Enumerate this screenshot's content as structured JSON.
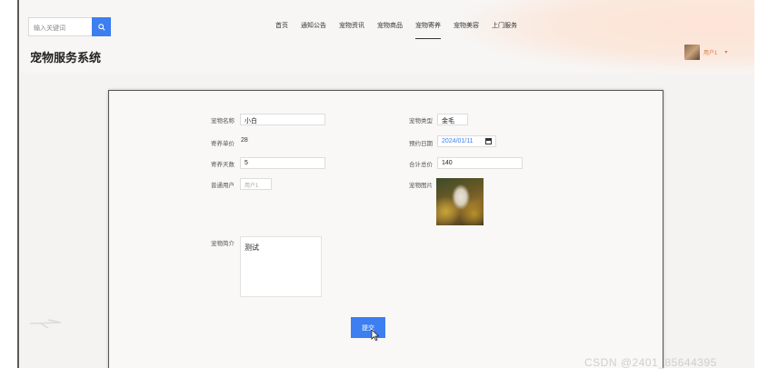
{
  "header": {
    "search_placeholder": "输入关键词",
    "site_title": "宠物服务系统",
    "nav": [
      "首页",
      "通知公告",
      "宠物资讯",
      "宠物商品",
      "宠物寄养",
      "宠物美容",
      "上门服务"
    ],
    "active_nav": "宠物寄养",
    "user_name": "用户1",
    "caret": "▾"
  },
  "form": {
    "pet_name_label": "宠物名称",
    "pet_name_value": "小白",
    "pet_type_label": "宠物类型",
    "pet_type_value": "金毛",
    "price_label": "寄养单价",
    "price_value": "28",
    "date_label": "预约日期",
    "date_value": "2024/01/11",
    "days_label": "寄养天数",
    "days_value": "5",
    "total_label": "合计总价",
    "total_value": "140",
    "user_label": "普通用户",
    "user_value": "用户1",
    "image_label": "宠物图片",
    "intro_label": "宠物简介",
    "intro_value": "测试",
    "submit_label": "提交"
  },
  "watermark": "CSDN @2401_85644395",
  "colors": {
    "accent": "#3d7ef0",
    "user": "#d9783a"
  }
}
